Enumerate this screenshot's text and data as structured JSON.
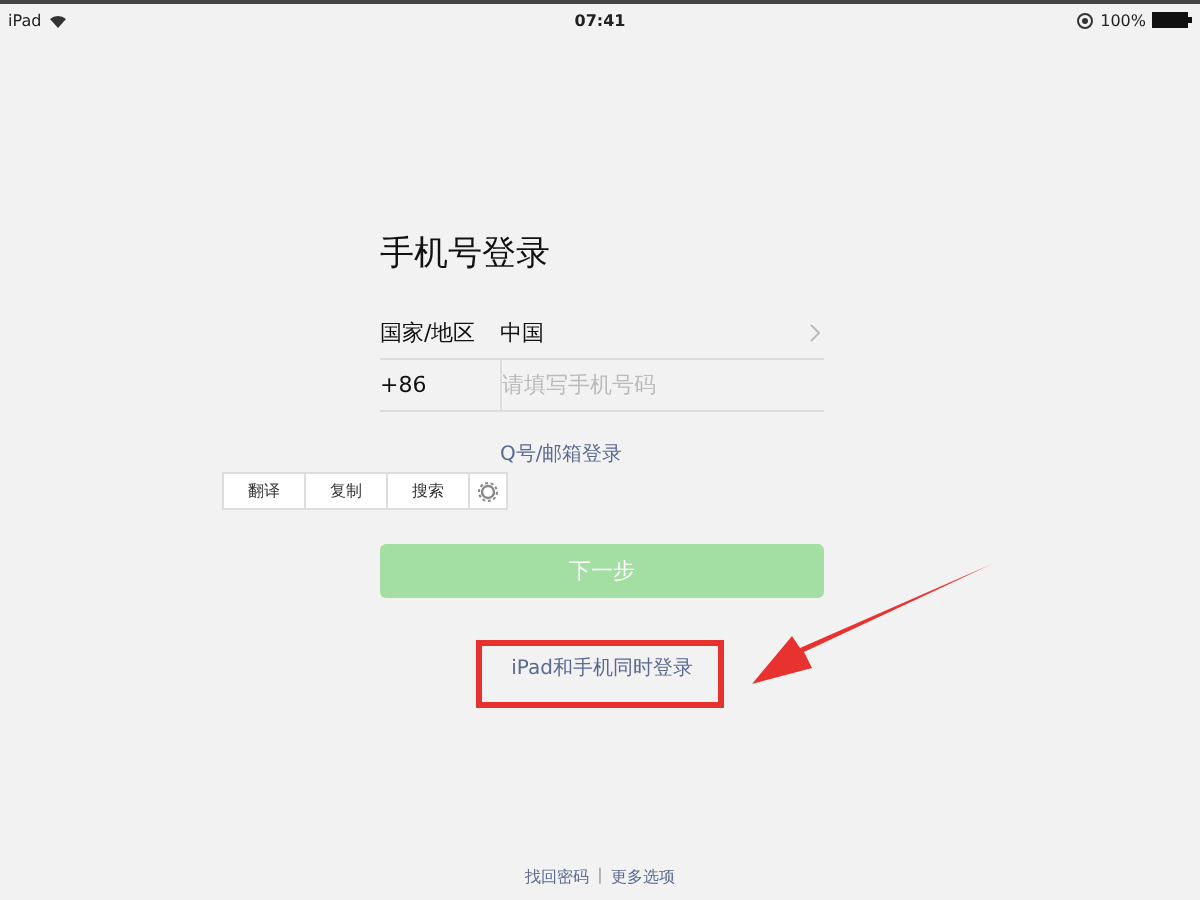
{
  "status_bar": {
    "device": "iPad",
    "time": "07:41",
    "battery": "100%"
  },
  "title": "手机号登录",
  "form": {
    "country_label": "国家/地区",
    "country_value": "中国",
    "code": "+86",
    "phone_placeholder": "请填写手机号码"
  },
  "alt_login_link": "Q号/邮箱登录",
  "context_menu": {
    "items": [
      "翻译",
      "复制",
      "搜索"
    ]
  },
  "next_button": {
    "label": "下一步",
    "disabled": true
  },
  "dual_login_link": "iPad和手机同时登录",
  "footer_links": [
    "找回密码",
    "更多选项"
  ],
  "footer_separator": "|"
}
